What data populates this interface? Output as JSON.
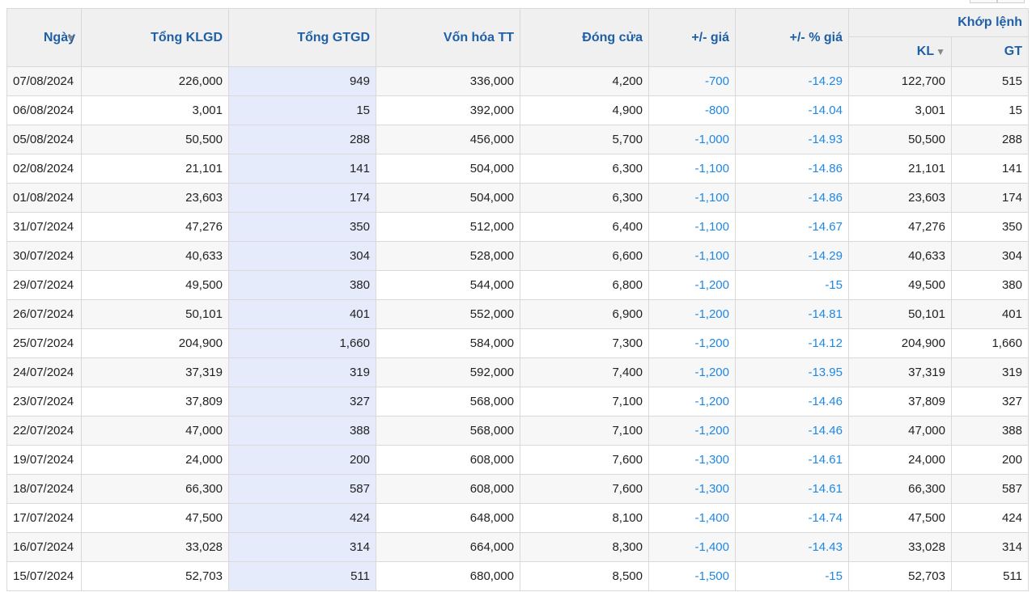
{
  "headers": {
    "date": "Ngày",
    "total_volume": "Tổng KLGD",
    "total_value": "Tổng GTGD",
    "market_cap": "Vốn hóa TT",
    "close": "Đóng cửa",
    "price_change": "+/- giá",
    "pct_change": "+/- % giá",
    "matched_group": "Khớp lệnh",
    "matched_volume": "KL",
    "matched_value": "GT",
    "sort_icon": "▼"
  },
  "colors": {
    "header_text": "#1f5fa6",
    "negative": "#1e88e5",
    "selected_column": "#e6ebfb"
  },
  "rows": [
    {
      "date": "07/08/2024",
      "total_volume": "226,000",
      "total_value": "949",
      "market_cap": "336,000",
      "close": "4,200",
      "price_change": "-700",
      "pct_change": "-14.29",
      "matched_volume": "122,700",
      "matched_value": "515"
    },
    {
      "date": "06/08/2024",
      "total_volume": "3,001",
      "total_value": "15",
      "market_cap": "392,000",
      "close": "4,900",
      "price_change": "-800",
      "pct_change": "-14.04",
      "matched_volume": "3,001",
      "matched_value": "15"
    },
    {
      "date": "05/08/2024",
      "total_volume": "50,500",
      "total_value": "288",
      "market_cap": "456,000",
      "close": "5,700",
      "price_change": "-1,000",
      "pct_change": "-14.93",
      "matched_volume": "50,500",
      "matched_value": "288"
    },
    {
      "date": "02/08/2024",
      "total_volume": "21,101",
      "total_value": "141",
      "market_cap": "504,000",
      "close": "6,300",
      "price_change": "-1,100",
      "pct_change": "-14.86",
      "matched_volume": "21,101",
      "matched_value": "141"
    },
    {
      "date": "01/08/2024",
      "total_volume": "23,603",
      "total_value": "174",
      "market_cap": "504,000",
      "close": "6,300",
      "price_change": "-1,100",
      "pct_change": "-14.86",
      "matched_volume": "23,603",
      "matched_value": "174"
    },
    {
      "date": "31/07/2024",
      "total_volume": "47,276",
      "total_value": "350",
      "market_cap": "512,000",
      "close": "6,400",
      "price_change": "-1,100",
      "pct_change": "-14.67",
      "matched_volume": "47,276",
      "matched_value": "350"
    },
    {
      "date": "30/07/2024",
      "total_volume": "40,633",
      "total_value": "304",
      "market_cap": "528,000",
      "close": "6,600",
      "price_change": "-1,100",
      "pct_change": "-14.29",
      "matched_volume": "40,633",
      "matched_value": "304"
    },
    {
      "date": "29/07/2024",
      "total_volume": "49,500",
      "total_value": "380",
      "market_cap": "544,000",
      "close": "6,800",
      "price_change": "-1,200",
      "pct_change": "-15",
      "matched_volume": "49,500",
      "matched_value": "380"
    },
    {
      "date": "26/07/2024",
      "total_volume": "50,101",
      "total_value": "401",
      "market_cap": "552,000",
      "close": "6,900",
      "price_change": "-1,200",
      "pct_change": "-14.81",
      "matched_volume": "50,101",
      "matched_value": "401"
    },
    {
      "date": "25/07/2024",
      "total_volume": "204,900",
      "total_value": "1,660",
      "market_cap": "584,000",
      "close": "7,300",
      "price_change": "-1,200",
      "pct_change": "-14.12",
      "matched_volume": "204,900",
      "matched_value": "1,660"
    },
    {
      "date": "24/07/2024",
      "total_volume": "37,319",
      "total_value": "319",
      "market_cap": "592,000",
      "close": "7,400",
      "price_change": "-1,200",
      "pct_change": "-13.95",
      "matched_volume": "37,319",
      "matched_value": "319"
    },
    {
      "date": "23/07/2024",
      "total_volume": "37,809",
      "total_value": "327",
      "market_cap": "568,000",
      "close": "7,100",
      "price_change": "-1,200",
      "pct_change": "-14.46",
      "matched_volume": "37,809",
      "matched_value": "327"
    },
    {
      "date": "22/07/2024",
      "total_volume": "47,000",
      "total_value": "388",
      "market_cap": "568,000",
      "close": "7,100",
      "price_change": "-1,200",
      "pct_change": "-14.46",
      "matched_volume": "47,000",
      "matched_value": "388"
    },
    {
      "date": "19/07/2024",
      "total_volume": "24,000",
      "total_value": "200",
      "market_cap": "608,000",
      "close": "7,600",
      "price_change": "-1,300",
      "pct_change": "-14.61",
      "matched_volume": "24,000",
      "matched_value": "200"
    },
    {
      "date": "18/07/2024",
      "total_volume": "66,300",
      "total_value": "587",
      "market_cap": "608,000",
      "close": "7,600",
      "price_change": "-1,300",
      "pct_change": "-14.61",
      "matched_volume": "66,300",
      "matched_value": "587"
    },
    {
      "date": "17/07/2024",
      "total_volume": "47,500",
      "total_value": "424",
      "market_cap": "648,000",
      "close": "8,100",
      "price_change": "-1,400",
      "pct_change": "-14.74",
      "matched_volume": "47,500",
      "matched_value": "424"
    },
    {
      "date": "16/07/2024",
      "total_volume": "33,028",
      "total_value": "314",
      "market_cap": "664,000",
      "close": "8,300",
      "price_change": "-1,400",
      "pct_change": "-14.43",
      "matched_volume": "33,028",
      "matched_value": "314"
    },
    {
      "date": "15/07/2024",
      "total_volume": "52,703",
      "total_value": "511",
      "market_cap": "680,000",
      "close": "8,500",
      "price_change": "-1,500",
      "pct_change": "-15",
      "matched_volume": "52,703",
      "matched_value": "511"
    }
  ]
}
